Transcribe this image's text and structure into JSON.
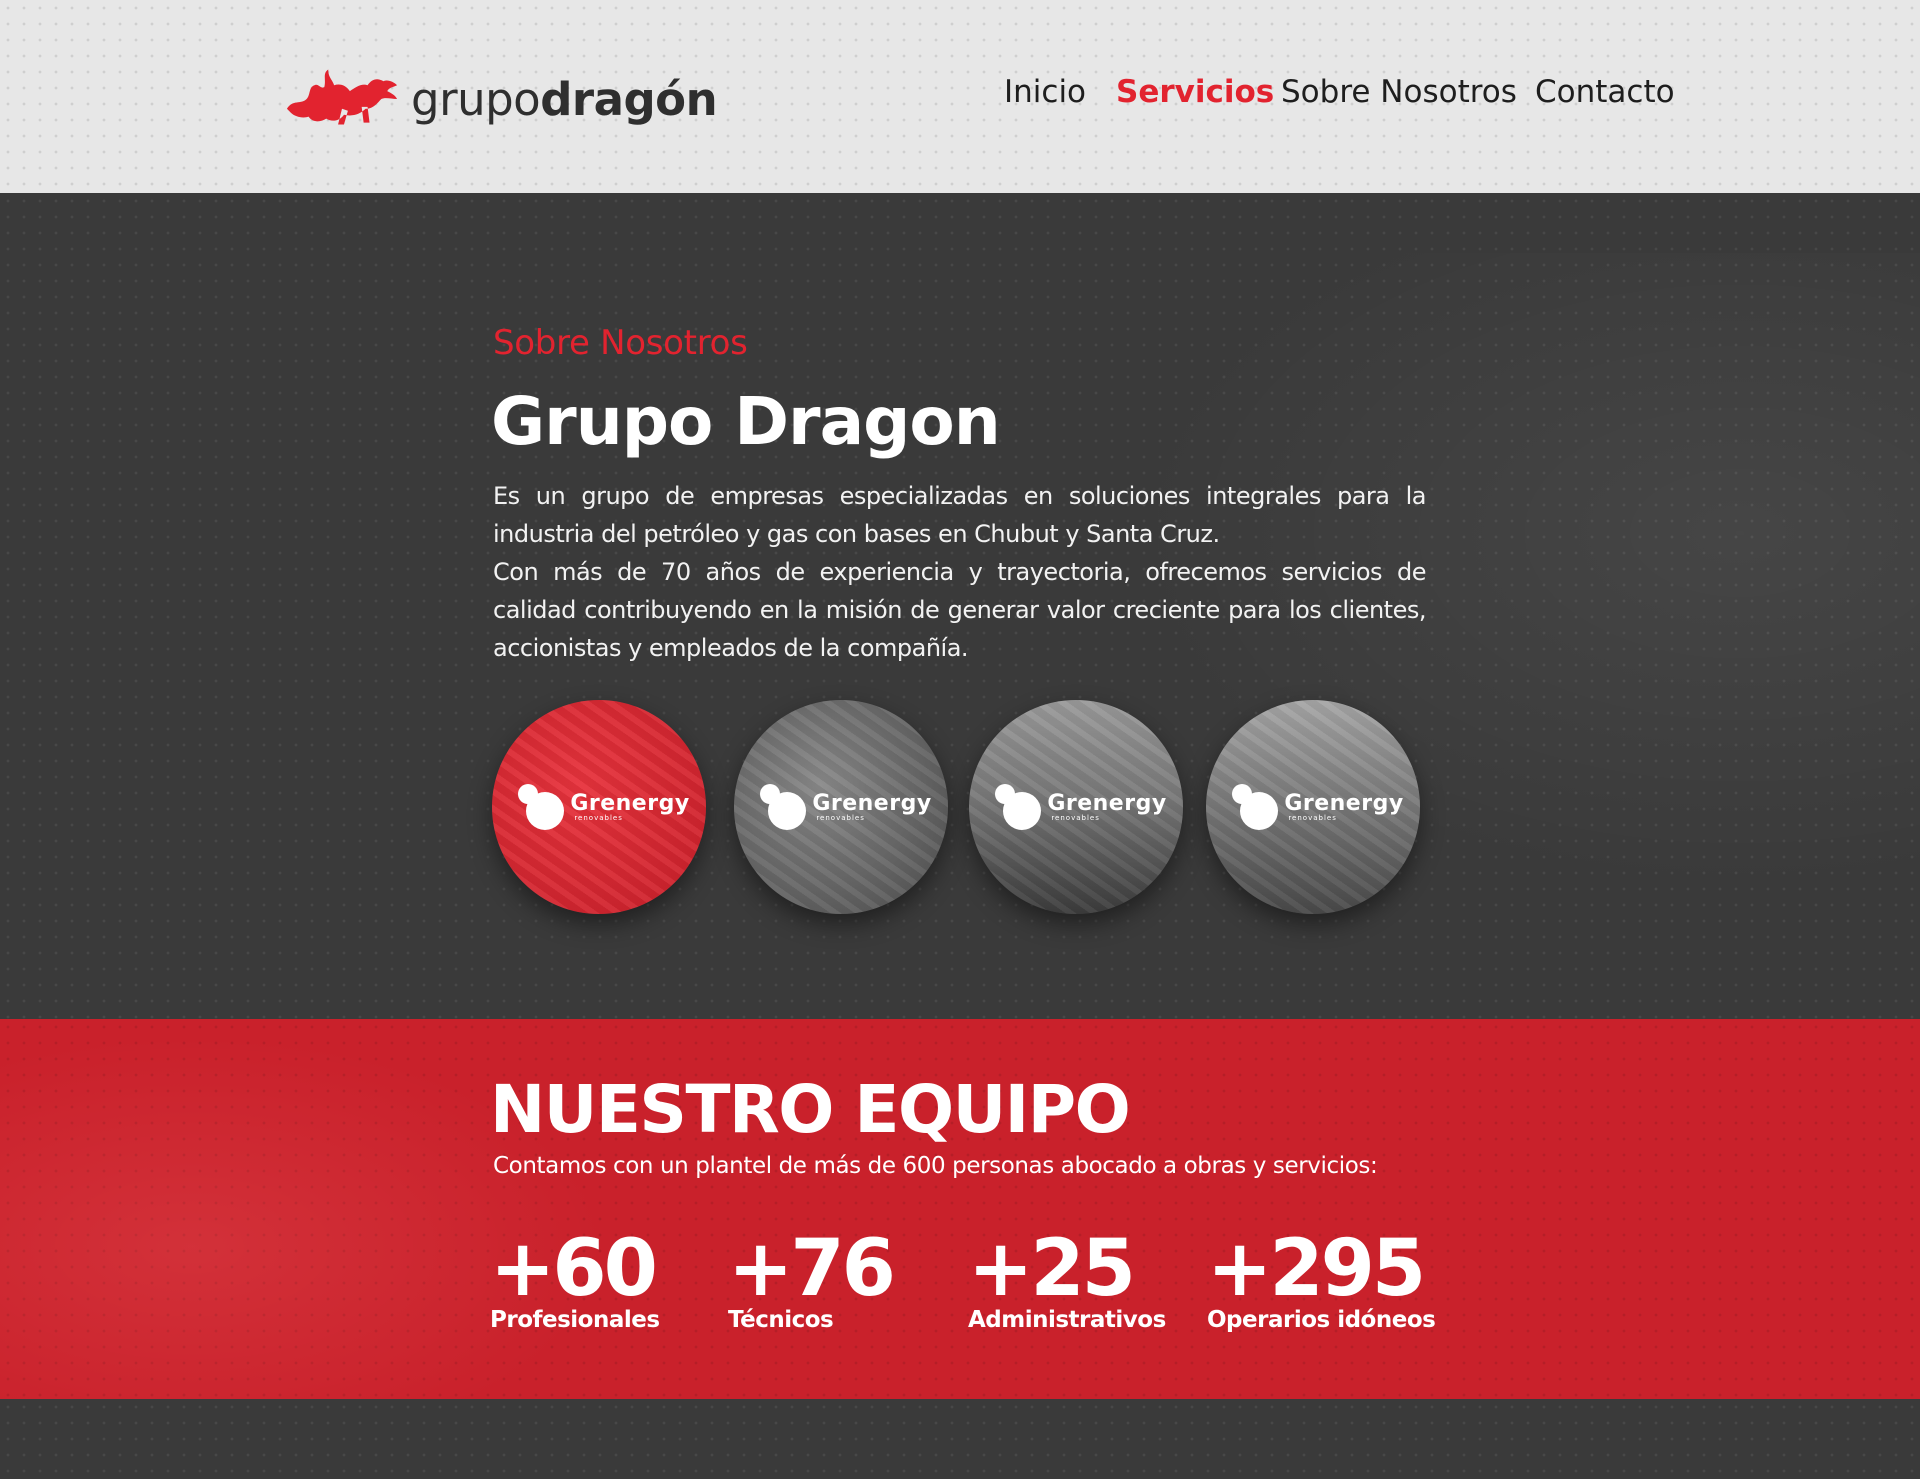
{
  "colors": {
    "accent": "#e2232f",
    "dark": "#3a3a3a",
    "header_bg": "#e7e7e7",
    "team_bg": "#c9212b"
  },
  "header": {
    "logo": {
      "icon": "dragon-icon",
      "text_light": "grupo",
      "text_bold": "dragón"
    },
    "nav": [
      {
        "label": "Inicio",
        "active": false
      },
      {
        "label": "Servicios",
        "active": true
      },
      {
        "label": "Sobre Nosotros",
        "active": false
      },
      {
        "label": "Contacto",
        "active": false
      }
    ]
  },
  "about": {
    "eyebrow": "Sobre Nosotros",
    "title": "Grupo Dragon",
    "paragraphs": [
      "Es un grupo de empresas especializadas en soluciones integrales para la industria del petróleo y gas con bases en Chubut y Santa Cruz.",
      "Con más de 70 años de experiencia y trayectoria, ofrecemos servicios de calidad contribuyendo en la misión de generar valor creciente para los clientes, accionistas y empleados de la compañía."
    ],
    "companies": [
      {
        "name": "Grenergy",
        "sub": "renovables",
        "highlight": true
      },
      {
        "name": "Grenergy",
        "sub": "renovables",
        "highlight": false
      },
      {
        "name": "Grenergy",
        "sub": "renovables",
        "highlight": false
      },
      {
        "name": "Grenergy",
        "sub": "renovables",
        "highlight": false
      }
    ]
  },
  "team": {
    "title": "NUESTRO EQUIPO",
    "subtitle": "Contamos con un plantel de más de 600 personas abocado a obras y servicios:",
    "stats": [
      {
        "value": "+60",
        "label": "Profesionales"
      },
      {
        "value": "+76",
        "label": "Técnicos"
      },
      {
        "value": "+25",
        "label": "Administrativos"
      },
      {
        "value": "+295",
        "label": "Operarios idóneos"
      }
    ]
  }
}
